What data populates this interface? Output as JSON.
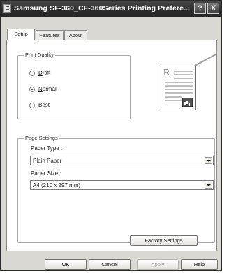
{
  "window": {
    "title": "Samsung SF-360_CF-360Series Printing Prefere...",
    "help_button": "?",
    "close_button": "X"
  },
  "tabs": [
    {
      "label": "Setup",
      "active": true
    },
    {
      "label": "Features",
      "active": false
    },
    {
      "label": "About",
      "active": false
    }
  ],
  "print_quality": {
    "group_label": "Print Quality",
    "options": [
      {
        "label": "Draft",
        "selected": false
      },
      {
        "label": "Normal",
        "selected": true
      },
      {
        "label": "Best",
        "selected": false
      }
    ]
  },
  "preview": {
    "letter": "R"
  },
  "page_settings": {
    "group_label": "Page Settings",
    "paper_type_label": "Paper Type :",
    "paper_type_value": "Plain Paper",
    "paper_size_label": "Paper Size :",
    "paper_size_value": "A4 (210 x 297 mm)"
  },
  "buttons": {
    "factory_settings": "Factory Settings",
    "ok": "OK",
    "cancel": "Cancel",
    "apply": "Apply",
    "help": "Help"
  },
  "colors": {
    "titlebar": "#2c2c2c",
    "dialog_background": "#d9d8d2",
    "panel_background": "#ffffff"
  }
}
